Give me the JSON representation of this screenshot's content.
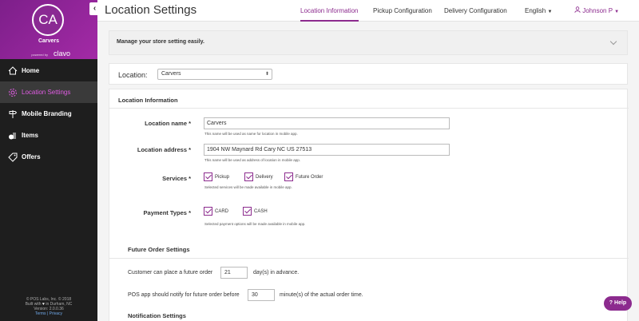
{
  "sidebar": {
    "avatar_initials": "CA",
    "brand_name": "Carvers",
    "powered_by": "powered by",
    "clavo": "clavo",
    "items": [
      {
        "label": "Home",
        "icon": "home-icon"
      },
      {
        "label": "Location Settings",
        "icon": "gear-icon"
      },
      {
        "label": "Mobile Branding",
        "icon": "signpost-icon"
      },
      {
        "label": "Items",
        "icon": "items-icon"
      },
      {
        "label": "Offers",
        "icon": "tag-icon"
      }
    ],
    "footer": {
      "copyright": "© POS Labs, Inc. © 2018",
      "built_with": "Built with",
      "built_location": "in Durham, NC",
      "version": "Version: 2.0.0.36",
      "terms": "Terms",
      "sep": "|",
      "privacy": "Privacy"
    }
  },
  "header": {
    "title": "Location Settings",
    "tabs": [
      {
        "label": "Location Information",
        "active": true
      },
      {
        "label": "Pickup Configuration",
        "active": false
      },
      {
        "label": "Delivery Configuration",
        "active": false
      }
    ],
    "language": "English",
    "user": "Johnson P"
  },
  "banner": {
    "text": "Manage your store setting easily."
  },
  "location_bar": {
    "label": "Location:",
    "selected": "Carvers"
  },
  "location_info": {
    "title": "Location Information",
    "name_label": "Location name *",
    "name_value": "Carvers",
    "name_hint": "This name will be used as name for location in mobile app.",
    "address_label": "Location address *",
    "address_value": "1904 NW Maynard Rd Cary NC US 27513",
    "address_hint": "This name will be used as address of location in mobile app.",
    "services_label": "Services *",
    "services": [
      "Pickup",
      "Delivery",
      "Future Order"
    ],
    "services_hint": "Selected services will be made available in mobile app.",
    "payment_label": "Payment Types *",
    "payments": [
      "CARD",
      "CASH"
    ],
    "payment_hint": "Selected payment options will be made available in mobile app."
  },
  "future_order": {
    "title": "Future Order Settings",
    "advance_prefix": "Customer can place a future order",
    "advance_value": "21",
    "advance_suffix": "day(s) in advance.",
    "notify_prefix": "POS app should notify for future order before",
    "notify_value": "30",
    "notify_suffix": "minute(s) of the actual order time."
  },
  "notification": {
    "title": "Notification Settings"
  },
  "help": {
    "label": "? Help"
  },
  "colors": {
    "accent": "#8c2b8e",
    "sidebar_bg": "#1e1e1e"
  }
}
